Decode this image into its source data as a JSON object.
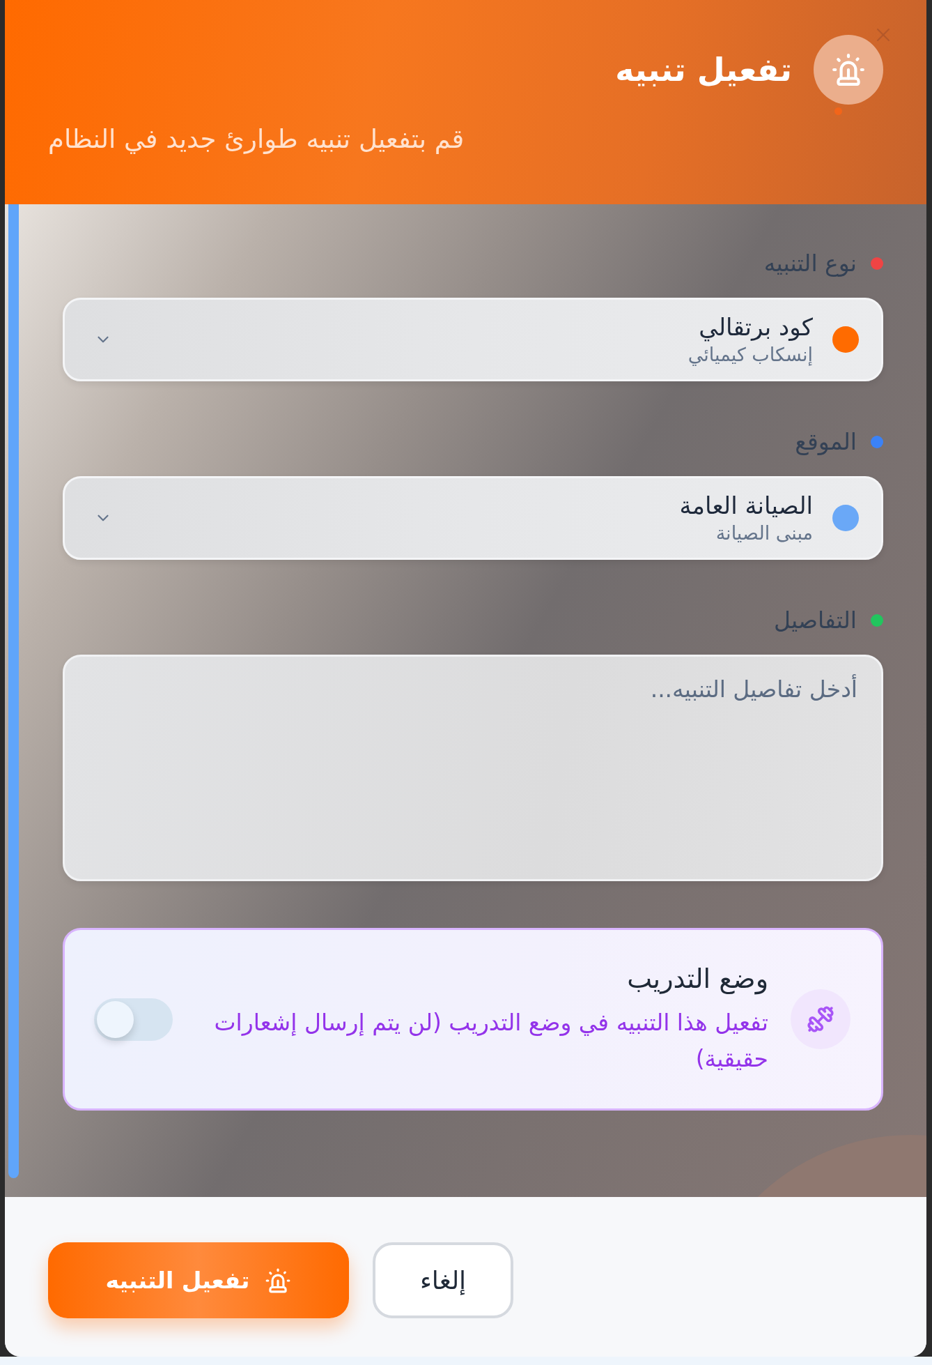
{
  "dialog": {
    "title": "تفعيل تنبيه",
    "subtitle": "قم بتفعيل تنبيه طوارئ جديد في النظام"
  },
  "fields": [
    {
      "kind": "select",
      "label": "نوع التنبيه",
      "color": "#ef4444",
      "value": {
        "title": "كود برتقالي",
        "subtitle": "إنسكاب كيميائي",
        "color": "#ff6b00"
      }
    },
    {
      "kind": "select",
      "label": "الموقع",
      "color": "#3b82f6",
      "value": {
        "title": "الصيانة العامة",
        "subtitle": "مبنى الصيانة",
        "color": "#6aa8f7"
      }
    },
    {
      "kind": "textarea",
      "label": "التفاصيل",
      "color": "#22c55e",
      "placeholder": "أدخل تفاصيل التنبيه..."
    }
  ],
  "training_mode": {
    "title": "وضع التدريب",
    "description": "تفعيل هذا التنبيه في وضع التدريب (لن يتم إرسال إشعارات حقيقية)",
    "on": false
  },
  "buttons": [
    {
      "kind": "secondary",
      "label": "إلغاء"
    },
    {
      "kind": "primary",
      "label": "تفعيل التنبيه"
    }
  ]
}
